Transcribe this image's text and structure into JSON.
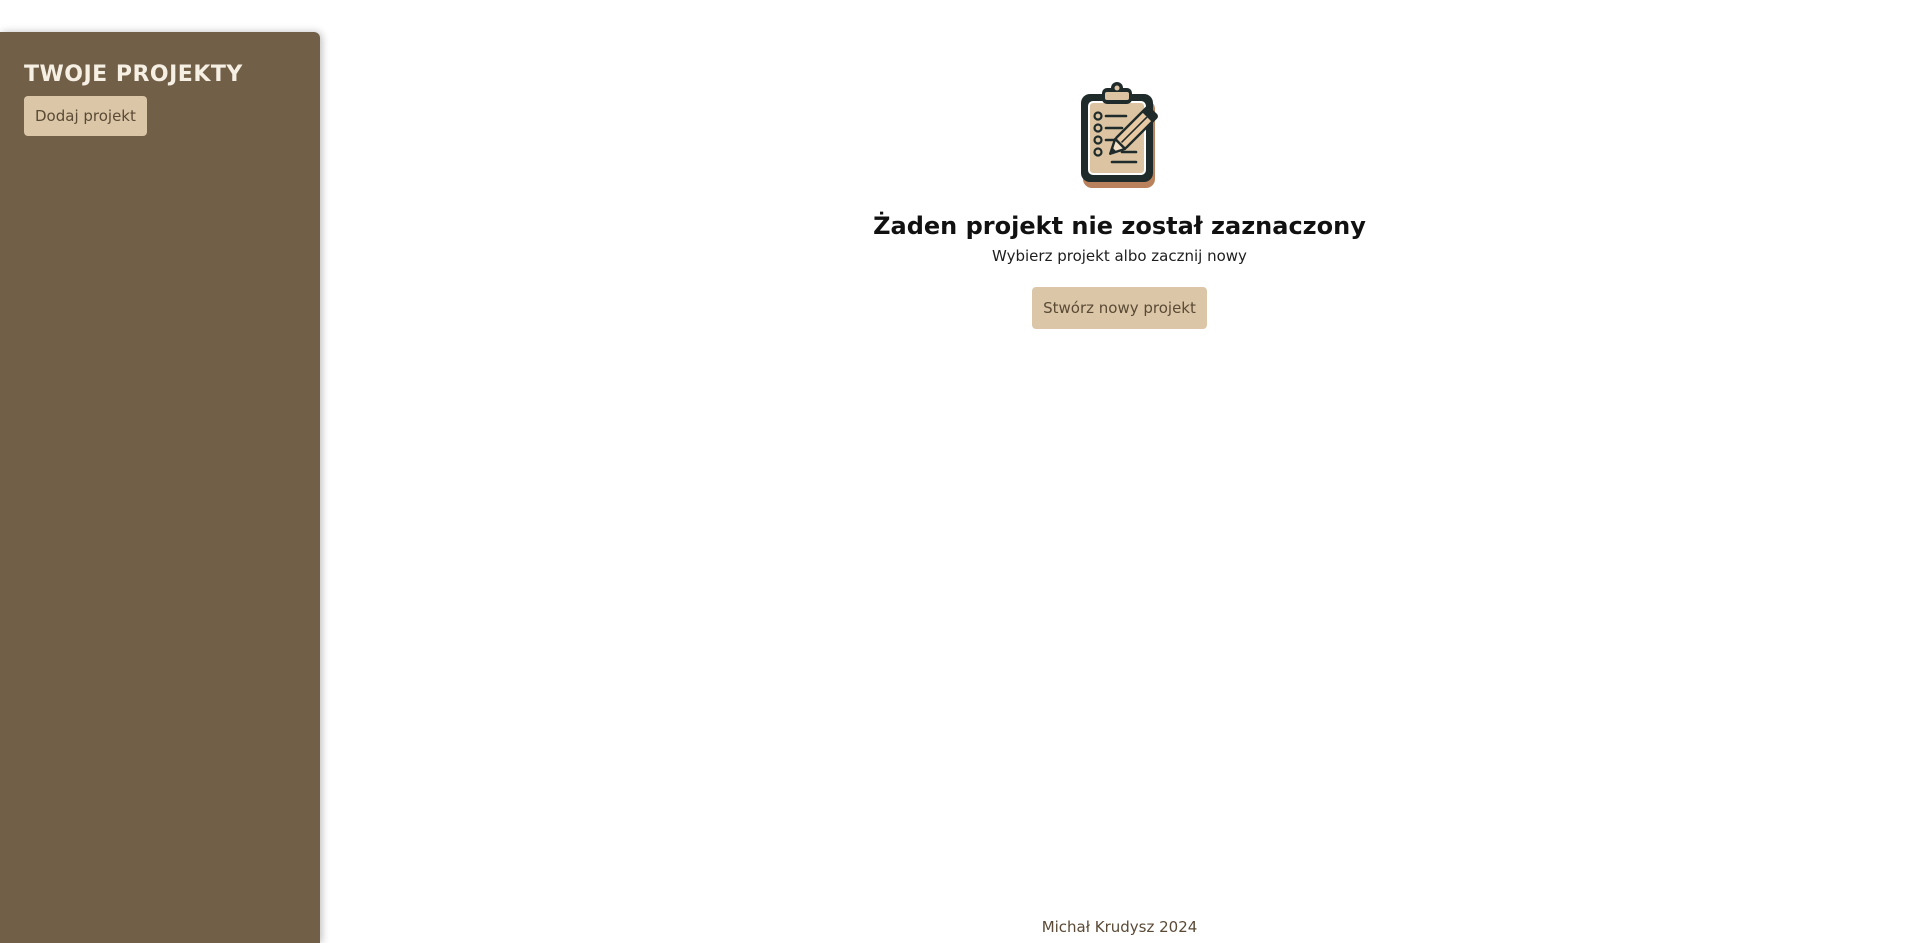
{
  "sidebar": {
    "title": "TWOJE PROJEKTY",
    "add_button_label": "Dodaj projekt"
  },
  "main": {
    "icon": "clipboard-pencil-icon",
    "title": "Żaden projekt nie został zaznaczony",
    "subtitle": "Wybierz projekt albo zacznij nowy",
    "create_button_label": "Stwórz nowy projekt"
  },
  "footer": {
    "text": "Michał Krudysz 2024"
  },
  "colors": {
    "sidebar_bg": "#715f47",
    "button_bg": "#dbc7a8",
    "button_text": "#5a4a35",
    "sidebar_title": "#f6efe4"
  }
}
